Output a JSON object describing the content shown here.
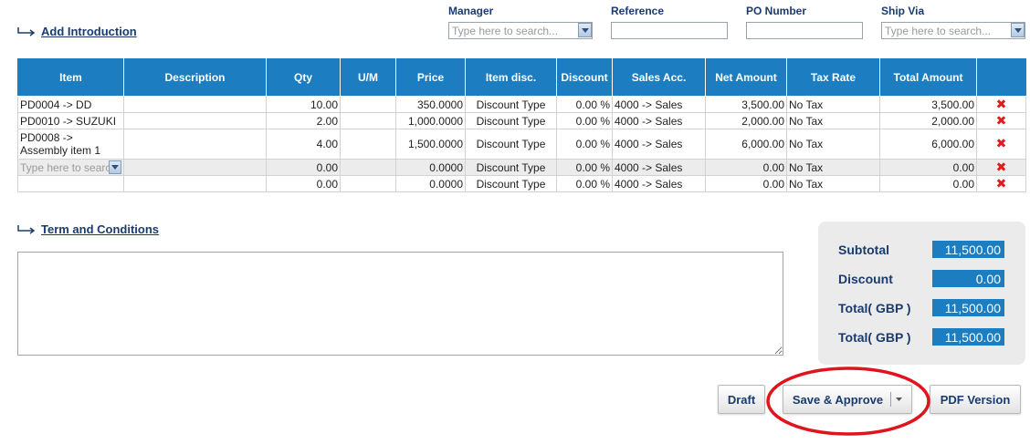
{
  "links": {
    "add_introduction": "Add Introduction",
    "term_and_conditions": "Term and Conditions"
  },
  "filters": {
    "manager": {
      "label": "Manager",
      "placeholder": "Type here to search..."
    },
    "reference": {
      "label": "Reference",
      "value": ""
    },
    "po_number": {
      "label": "PO Number",
      "value": ""
    },
    "ship_via": {
      "label": "Ship Via",
      "placeholder": "Type here to search..."
    }
  },
  "table": {
    "columns": [
      "Item",
      "Description",
      "Qty",
      "U/M",
      "Price",
      "Item disc.",
      "Discount",
      "Sales Acc.",
      "Net Amount",
      "Tax Rate",
      "Total Amount"
    ],
    "rows": [
      {
        "item": "PD0004 -> DD",
        "description": "",
        "qty": "10.00",
        "um": "",
        "price": "350.0000",
        "item_disc": "Discount Type",
        "discount": "0.00 %",
        "sales_acc": "4000 -> Sales",
        "net_amount": "3,500.00",
        "tax_rate": "No Tax",
        "total_amount": "3,500.00"
      },
      {
        "item": "PD0010 -> SUZUKI",
        "description": "",
        "qty": "2.00",
        "um": "",
        "price": "1,000.0000",
        "item_disc": "Discount Type",
        "discount": "0.00 %",
        "sales_acc": "4000 -> Sales",
        "net_amount": "2,000.00",
        "tax_rate": "No Tax",
        "total_amount": "2,000.00"
      },
      {
        "item": "PD0008 -> Assembly item 1",
        "description": "",
        "qty": "4.00",
        "um": "",
        "price": "1,500.0000",
        "item_disc": "Discount Type",
        "discount": "0.00 %",
        "sales_acc": "4000 -> Sales",
        "net_amount": "6,000.00",
        "tax_rate": "No Tax",
        "total_amount": "6,000.00"
      },
      {
        "item_placeholder": "Type here to search...",
        "description": "",
        "qty": "0.00",
        "um": "",
        "price": "0.0000",
        "item_disc": "Discount Type",
        "discount": "0.00 %",
        "sales_acc": "4000 -> Sales",
        "net_amount": "0.00",
        "tax_rate": "No Tax",
        "total_amount": "0.00"
      },
      {
        "item": "",
        "description": "",
        "qty": "0.00",
        "um": "",
        "price": "0.0000",
        "item_disc": "Discount Type",
        "discount": "0.00 %",
        "sales_acc": "4000 -> Sales",
        "net_amount": "0.00",
        "tax_rate": "No Tax",
        "total_amount": "0.00"
      }
    ],
    "delete_symbol": "✖"
  },
  "totals": {
    "subtotal": {
      "label": "Subtotal",
      "value": "11,500.00"
    },
    "discount": {
      "label": "Discount",
      "value": "0.00"
    },
    "total1": {
      "label": "Total( GBP )",
      "value": "11,500.00"
    },
    "total2": {
      "label": "Total( GBP )",
      "value": "11,500.00"
    }
  },
  "buttons": {
    "draft": "Draft",
    "save_approve": "Save & Approve",
    "pdf_version": "PDF Version"
  },
  "colors": {
    "header_blue": "#1c7ec1",
    "link_navy": "#1a3b6e",
    "delete_red": "#e21c1c",
    "annotation_red": "#e0141c"
  },
  "icons": {
    "section_arrow": "return-arrow-icon",
    "combo": "chevron-down-icon",
    "delete": "delete-x-icon"
  }
}
